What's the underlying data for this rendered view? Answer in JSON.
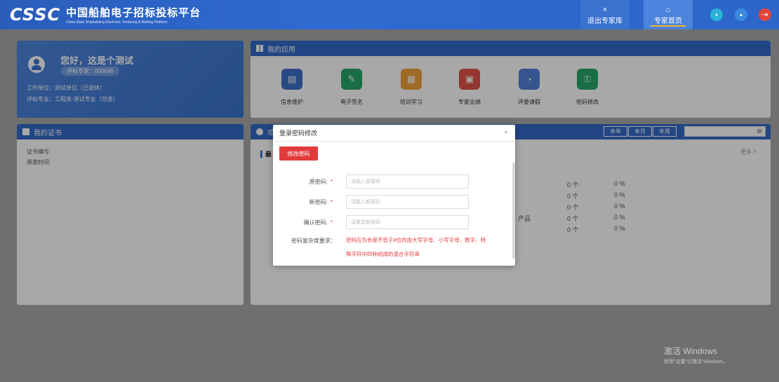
{
  "header": {
    "logo_mark": "CSSC",
    "title": "中国船舶电子招标投标平台",
    "subtitle": "China State Shipbuilding Electronic Tendering & Bidding Platform",
    "nav": [
      {
        "icon": "close-icon",
        "glyph": "×",
        "label": "退出专家库"
      },
      {
        "icon": "home-icon",
        "glyph": "⌂",
        "label": "专家首页"
      }
    ],
    "buttons": [
      {
        "icon": "bell-icon",
        "glyph": "●",
        "color": "#2ab2d8"
      },
      {
        "icon": "user-icon",
        "glyph": "▲",
        "color": "#3a72d8"
      },
      {
        "icon": "logout-icon",
        "glyph": "⇥",
        "color": "#e2453e"
      }
    ]
  },
  "profile": {
    "greeting": "您好，这是个测试",
    "badge": "评标专家：000646",
    "company": "工作单位：测试单位（已退休）",
    "specialty": "评标专业：工程类-测试专业（勿选）"
  },
  "apps": {
    "title": "我的应用",
    "items": [
      {
        "label": "信息维护",
        "color": "#3e6fc8",
        "glyph": "▤",
        "icon": "info-maintenance-icon"
      },
      {
        "label": "电子签名",
        "color": "#27a86a",
        "glyph": "✎",
        "icon": "e-signature-icon"
      },
      {
        "label": "培训学习",
        "color": "#f0a23a",
        "glyph": "▦",
        "icon": "training-icon"
      },
      {
        "label": "专家业绩",
        "color": "#e2524a",
        "glyph": "▣",
        "icon": "expert-performance-icon"
      },
      {
        "label": "评委请假",
        "color": "#4f82d8",
        "glyph": "◔",
        "icon": "leave-request-icon"
      },
      {
        "label": "密码修改",
        "color": "#27a86a",
        "glyph": "⚿",
        "icon": "password-change-icon"
      }
    ]
  },
  "cert": {
    "title": "我的证书",
    "number_label": "证书编号:",
    "date_label": "颁发时间:"
  },
  "stats": {
    "title_fragment": "项",
    "subtitle_fragment": "最",
    "periods": [
      "本年",
      "本月",
      "本周"
    ],
    "more": "更多 >",
    "rows": [
      {
        "label": "",
        "count": "0 个",
        "pct": "0 %"
      },
      {
        "label": "",
        "count": "0 个",
        "pct": "0 %"
      },
      {
        "label": "",
        "count": "0 个",
        "pct": "0 %"
      },
      {
        "label": "产品",
        "count": "0 个",
        "pct": "0 %"
      },
      {
        "label": "",
        "count": "0 个",
        "pct": "0 %"
      }
    ]
  },
  "modal": {
    "title": "登录密码修改",
    "close": "×",
    "tab": "修改密码",
    "fields": [
      {
        "label": "原密码:",
        "placeholder": "请输入原密码"
      },
      {
        "label": "新密码:",
        "placeholder": "请输入新密码"
      },
      {
        "label": "确认密码:",
        "placeholder": "请重复新密码"
      }
    ],
    "required_mark": "*",
    "hint_label": "密码复杂度要求：",
    "hint_line1": "密码应为长度不低于8位的由大写字母、小写字母、数字、特",
    "hint_line2": "殊字符中四种组成的混合字符串"
  },
  "watermark": {
    "line1": "激活 Windows",
    "line2": "转到\"设置\"以激活 Windows。"
  }
}
